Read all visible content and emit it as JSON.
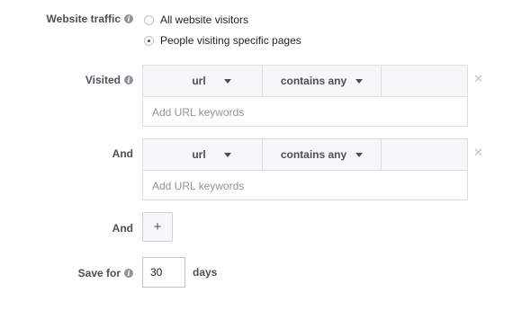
{
  "website_traffic": {
    "label": "Website traffic",
    "options": [
      {
        "label": "All website visitors",
        "checked": false
      },
      {
        "label": "People visiting specific pages",
        "checked": true
      }
    ]
  },
  "rules": [
    {
      "label": "Visited",
      "field": "url",
      "operator": "contains any",
      "placeholder": "Add URL keywords"
    },
    {
      "label": "And",
      "field": "url",
      "operator": "contains any",
      "placeholder": "Add URL keywords"
    }
  ],
  "add_rule": {
    "label": "And",
    "button": "+"
  },
  "save_for": {
    "label": "Save for",
    "value": "30",
    "unit": "days"
  },
  "icons": {
    "info": "info-icon",
    "remove": "close-icon",
    "caret": "chevron-down-icon"
  }
}
